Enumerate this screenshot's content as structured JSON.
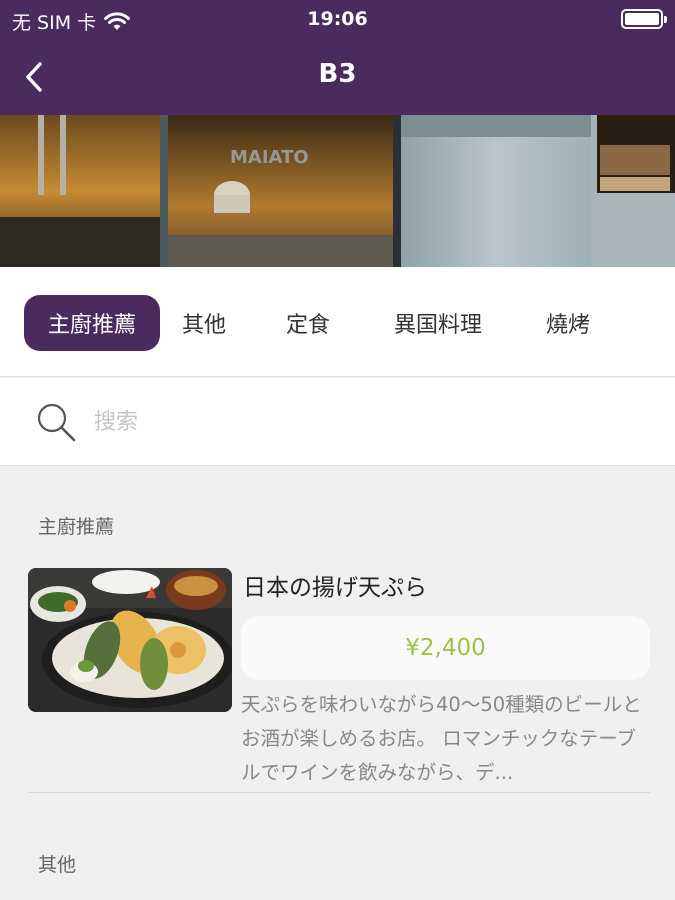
{
  "status_bar": {
    "carrier": "无 SIM 卡",
    "time": "19:06"
  },
  "nav": {
    "title": "B3"
  },
  "tabs": [
    {
      "label": "主廚推薦",
      "active": true
    },
    {
      "label": "其他",
      "active": false
    },
    {
      "label": "定食",
      "active": false
    },
    {
      "label": "異国料理",
      "active": false
    },
    {
      "label": "燒烤",
      "active": false
    }
  ],
  "search": {
    "placeholder": "搜索"
  },
  "sections": [
    {
      "title": "主廚推薦",
      "items": [
        {
          "name": "日本の揚げ天ぷら",
          "price": "¥2,400",
          "description": "天ぷらを味わいながら40～50種類のビールとお酒が楽しめるお店。 ロマンチックなテーブルでワインを飲みながら、デ..."
        }
      ]
    },
    {
      "title": "其他",
      "items": []
    }
  ],
  "colors": {
    "primary": "#4b2a5e",
    "price": "#9dc24a",
    "background": "#f0f0f0"
  }
}
